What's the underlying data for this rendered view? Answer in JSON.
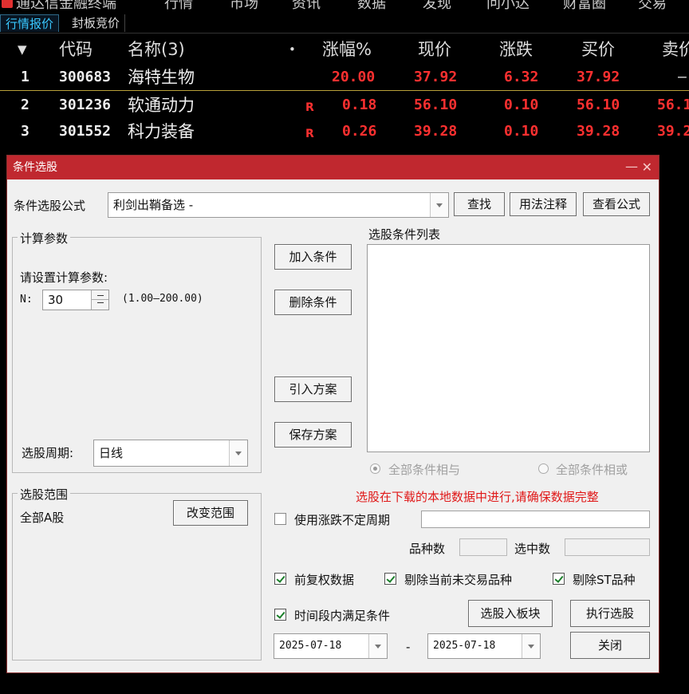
{
  "top_menu": [
    "通达信金融终端",
    "行情",
    "市场",
    "资讯",
    "数据",
    "发现",
    "问小达",
    "财富圈",
    "交易"
  ],
  "tabs": [
    "行情报价",
    "封板竞价"
  ],
  "quote_table": {
    "headers": {
      "sort": "▼",
      "code": "代码",
      "name": "名称(3)",
      "dot": "•",
      "change_pct": "涨幅%",
      "price": "现价",
      "change": "涨跌",
      "bid": "买价",
      "ask": "卖价"
    },
    "rows": [
      {
        "idx": "1",
        "code": "300683",
        "name": "海特生物",
        "flag": "",
        "change_pct": "20.00",
        "price": "37.92",
        "change": "6.32",
        "bid": "37.92",
        "ask": "—"
      },
      {
        "idx": "2",
        "code": "301236",
        "name": "软通动力",
        "flag": "R",
        "change_pct": "0.18",
        "price": "56.10",
        "change": "0.10",
        "bid": "56.10",
        "ask": "56.1"
      },
      {
        "idx": "3",
        "code": "301552",
        "name": "科力装备",
        "flag": "R",
        "change_pct": "0.26",
        "price": "39.28",
        "change": "0.10",
        "bid": "39.28",
        "ask": "39.2"
      }
    ]
  },
  "dialog": {
    "title": "条件选股",
    "minimize": "—",
    "close": "✕",
    "formula_label": "条件选股公式",
    "formula_value": "利剑出鞘备选  -",
    "btn_find": "查找",
    "btn_usage": "用法注释",
    "btn_view": "查看公式",
    "params_group": "计算参数",
    "params_prompt": "请设置计算参数:",
    "param_name": "N:",
    "param_value": "30",
    "param_range": "(1.00—200.00)",
    "period_label": "选股周期:",
    "period_value": "日线",
    "scope_group": "选股范围",
    "scope_value": "全部A股",
    "btn_change_scope": "改变范围",
    "btn_add": "加入条件",
    "btn_delete": "删除条件",
    "btn_import": "引入方案",
    "btn_save": "保存方案",
    "list_title": "选股条件列表",
    "radio_and": "全部条件相与",
    "radio_or": "全部条件相或",
    "warning": "选股在下载的本地数据中进行,请确保数据完整",
    "use_period_label": "使用涨跌不定周期",
    "count_label": "品种数",
    "selected_label": "选中数",
    "cb_adjusted": "前复权数据",
    "cb_exclude_untraded": "剔除当前未交易品种",
    "cb_exclude_st": "剔除ST品种",
    "cb_timerange": "时间段内满足条件",
    "btn_to_block": "选股入板块",
    "btn_execute": "执行选股",
    "date_from": "2025-07-18",
    "date_sep": "-",
    "date_to": "2025-07-18",
    "btn_close": "关闭"
  },
  "colors": {
    "up": "#ff3030",
    "title_bar": "#c0282f",
    "tab_active": "#39c8ff"
  }
}
